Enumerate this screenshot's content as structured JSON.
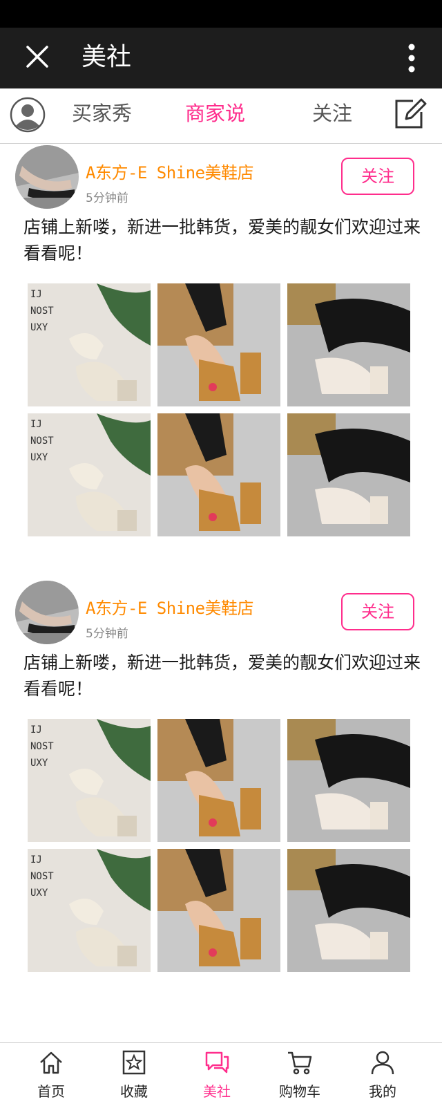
{
  "titlebar": {
    "title": "美社",
    "close_icon": "close-icon",
    "more_icon": "more-vertical-icon"
  },
  "tabs": [
    {
      "label": "买家秀",
      "active": false
    },
    {
      "label": "商家说",
      "active": true
    },
    {
      "label": "关注",
      "active": false
    }
  ],
  "tabbar": {
    "user_icon": "user-avatar-icon",
    "edit_icon": "edit-icon"
  },
  "posts": [
    {
      "shop_name": "A东方-E Shine美鞋店",
      "time": "5分钟前",
      "follow_label": "关注",
      "content": "店铺上新喽，新进一批韩货，爱美的靓女们欢迎过来看看呢！"
    },
    {
      "shop_name": "A东方-E Shine美鞋店",
      "time": "5分钟前",
      "follow_label": "关注",
      "content": "店铺上新喽，新进一批韩货，爱美的靓女们欢迎过来看看呢！"
    }
  ],
  "bottom_nav": [
    {
      "label": "首页",
      "icon": "home-icon",
      "active": false
    },
    {
      "label": "收藏",
      "icon": "star-icon",
      "active": false
    },
    {
      "label": "美社",
      "icon": "chat-icon",
      "active": true
    },
    {
      "label": "购物车",
      "icon": "cart-icon",
      "active": false
    },
    {
      "label": "我的",
      "icon": "person-icon",
      "active": false
    }
  ],
  "colors": {
    "accent": "#ff2d8c",
    "shop_name": "#ff8a00",
    "titlebar": "#1d1d1d"
  }
}
